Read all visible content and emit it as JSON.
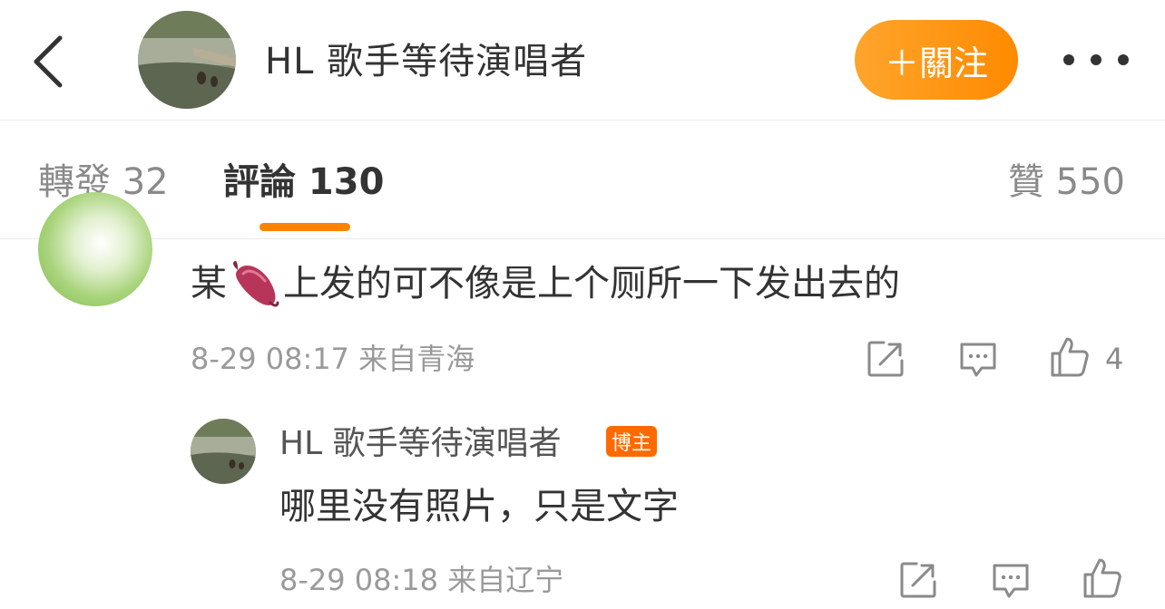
{
  "header": {
    "title": "HL 歌手等待演唱者",
    "follow_label": "＋關注"
  },
  "tabs": {
    "repost": "轉發 32",
    "comments": "評論 130",
    "likes": "贊 550"
  },
  "comments": [
    {
      "text_before": "某",
      "emoji": "sweet-potato-icon",
      "text_after": "上发的可不像是上个厕所一下发出去的",
      "meta": "8-29 08:17  来自青海",
      "like_count": "4",
      "reply": {
        "author": "HL 歌手等待演唱者",
        "badge": "博主",
        "text": "哪里没有照片，只是文字",
        "meta": "8-29 08:18  来自辽宁"
      }
    }
  ],
  "colors": {
    "accent": "#ff8200",
    "follow_gradient_start": "#ffa52c",
    "follow_gradient_end": "#ff8a00",
    "badge": "#ff6a00",
    "meta_text": "#9a9a9a"
  }
}
